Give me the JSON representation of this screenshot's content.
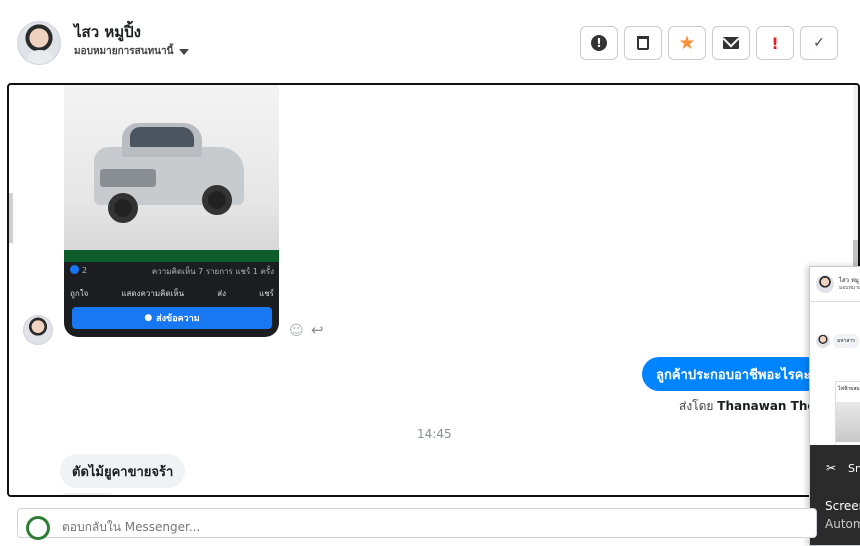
{
  "header": {
    "name": "ไสว หมูปิ้ง",
    "assign_label": "มอบหมายการสนทนานี้",
    "toolbar": {
      "icons": [
        "alert-icon",
        "trash-icon",
        "star-icon",
        "mail-icon",
        "exclamation-icon",
        "check-icon"
      ],
      "exclamation_text": "!",
      "check_text": "✓"
    }
  },
  "post_card": {
    "like_count": "2",
    "comments_shares": "ความคิดเห็น 7 รายการ แชร์ 1 ครั้ง",
    "actions": [
      "ถูกใจ",
      "แสดงความคิดเห็น",
      "ส่ง",
      "แชร์"
    ],
    "send_message": "ส่งข้อความ"
  },
  "messages": {
    "outgoing": "ลูกค้าประกอบอาชีพอะไรคะ",
    "sent_by_prefix": "ส่งโดย",
    "sent_by_name": "Thanawan Thon",
    "timestamp": "14:45",
    "incoming": "ตัดไม้ยูคาขายจร้า"
  },
  "popup": {
    "name": "ไสว หมู",
    "sub": "มอบหมาย",
    "chip": "มหาสาร",
    "card_text": "ไฟฟ้าผสม",
    "snip_label": "Sn",
    "screen_label": "Screen",
    "auto_label": "Autom"
  },
  "composer": {
    "placeholder": "ตอบกลับใน Messenger..."
  },
  "colors": {
    "accent": "#0084ff",
    "facebook_blue": "#1877f2",
    "star": "#f7923a",
    "alert_red": "#e02424"
  }
}
